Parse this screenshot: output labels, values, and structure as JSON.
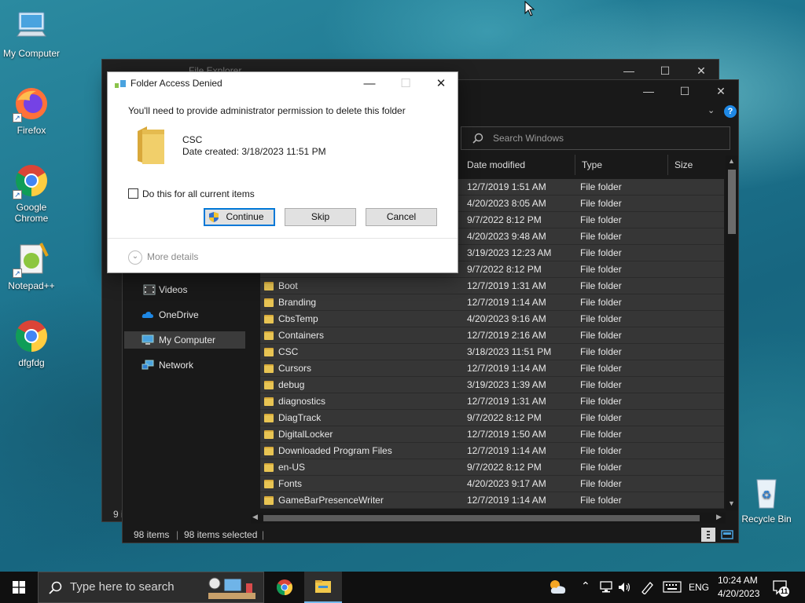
{
  "desktop": {
    "icons": [
      {
        "label": "My Computer",
        "icon": "computer-icon"
      },
      {
        "label": "Firefox",
        "icon": "firefox-icon"
      },
      {
        "label": "Google Chrome",
        "icon": "chrome-icon"
      },
      {
        "label": "Notepad++",
        "icon": "notepadpp-icon"
      },
      {
        "label": "dfgfdg",
        "icon": "chrome-icon"
      },
      {
        "label": "Recycle Bin",
        "icon": "recycle-bin-icon"
      }
    ]
  },
  "explorer_back": {
    "title": "File Explorer",
    "status_fragment": "9 i"
  },
  "explorer": {
    "search_placeholder": "Search Windows",
    "columns": [
      "Date modified",
      "Type",
      "Size"
    ],
    "nav": [
      {
        "label": "Videos",
        "icon": "videos-icon"
      },
      {
        "label": "OneDrive",
        "icon": "onedrive-icon"
      },
      {
        "label": "My Computer",
        "icon": "computer-icon"
      },
      {
        "label": "Network",
        "icon": "network-icon"
      }
    ],
    "top_rows": [
      {
        "date": "12/7/2019 1:51 AM",
        "type": "File folder"
      },
      {
        "date": "4/20/2023 8:05 AM",
        "type": "File folder"
      },
      {
        "date": "9/7/2022 8:12 PM",
        "type": "File folder"
      },
      {
        "date": "4/20/2023 9:48 AM",
        "type": "File folder"
      },
      {
        "date": "3/19/2023 12:23 AM",
        "type": "File folder"
      },
      {
        "date": "9/7/2022 8:12 PM",
        "type": "File folder"
      }
    ],
    "rows": [
      {
        "name": "Boot",
        "date": "12/7/2019 1:31 AM",
        "type": "File folder"
      },
      {
        "name": "Branding",
        "date": "12/7/2019 1:14 AM",
        "type": "File folder"
      },
      {
        "name": "CbsTemp",
        "date": "4/20/2023 9:16 AM",
        "type": "File folder"
      },
      {
        "name": "Containers",
        "date": "12/7/2019 2:16 AM",
        "type": "File folder"
      },
      {
        "name": "CSC",
        "date": "3/18/2023 11:51 PM",
        "type": "File folder"
      },
      {
        "name": "Cursors",
        "date": "12/7/2019 1:14 AM",
        "type": "File folder"
      },
      {
        "name": "debug",
        "date": "3/19/2023 1:39 AM",
        "type": "File folder"
      },
      {
        "name": "diagnostics",
        "date": "12/7/2019 1:31 AM",
        "type": "File folder"
      },
      {
        "name": "DiagTrack",
        "date": "9/7/2022 8:12 PM",
        "type": "File folder"
      },
      {
        "name": "DigitalLocker",
        "date": "12/7/2019 1:50 AM",
        "type": "File folder"
      },
      {
        "name": "Downloaded Program Files",
        "date": "12/7/2019 1:14 AM",
        "type": "File folder"
      },
      {
        "name": "en-US",
        "date": "9/7/2022 8:12 PM",
        "type": "File folder"
      },
      {
        "name": "Fonts",
        "date": "4/20/2023 9:17 AM",
        "type": "File folder"
      },
      {
        "name": "GameBarPresenceWriter",
        "date": "12/7/2019 1:14 AM",
        "type": "File folder"
      }
    ],
    "status": {
      "items": "98 items",
      "selected": "98 items selected"
    }
  },
  "dialog": {
    "title": "Folder Access Denied",
    "message": "You'll need to provide administrator permission to delete this folder",
    "folder_name": "CSC",
    "folder_date": "Date created: 3/18/2023 11:51 PM",
    "checkbox_label": "Do this for all current items",
    "checkbox_checked": false,
    "buttons": {
      "continue": "Continue",
      "skip": "Skip",
      "cancel": "Cancel"
    },
    "more_details": "More details"
  },
  "taskbar": {
    "search_placeholder": "Type here to search",
    "language": "ENG",
    "time": "10:24 AM",
    "date": "4/20/2023",
    "notification_count": "11"
  },
  "colors": {
    "accent": "#0078d7",
    "folder": "#e8c453"
  }
}
